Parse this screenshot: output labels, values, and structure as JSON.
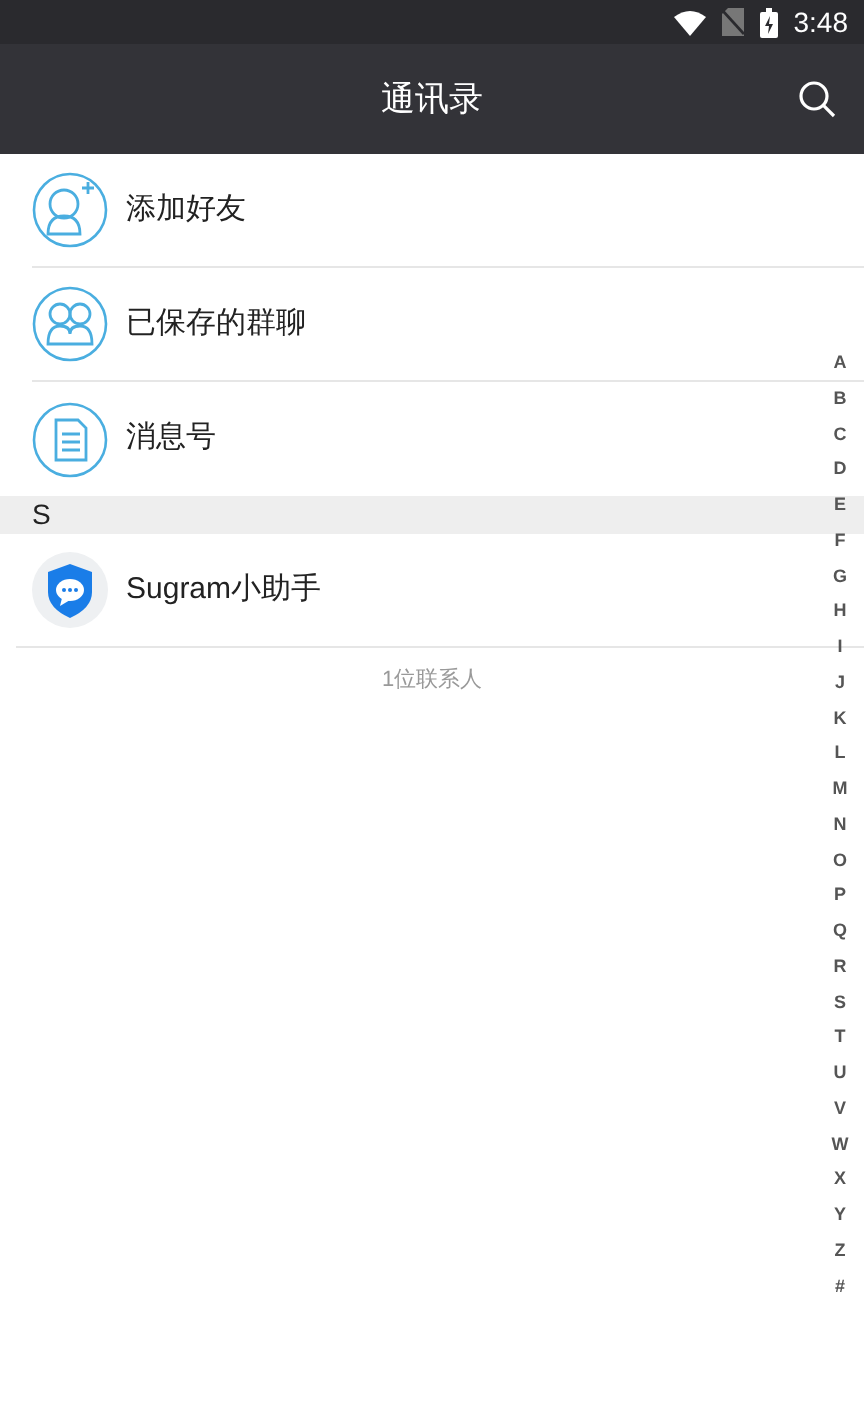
{
  "status_bar": {
    "time": "3:48"
  },
  "header": {
    "title": "通讯录"
  },
  "shortcuts": [
    {
      "kind": "add-friend",
      "label": "添加好友"
    },
    {
      "kind": "group",
      "label": "已保存的群聊"
    },
    {
      "kind": "document",
      "label": "消息号"
    }
  ],
  "sections": [
    {
      "letter": "S",
      "contacts": [
        {
          "name": "Sugram小助手"
        }
      ]
    }
  ],
  "contact_count": "1位联系人",
  "index": [
    "A",
    "B",
    "C",
    "D",
    "E",
    "F",
    "G",
    "H",
    "I",
    "J",
    "K",
    "L",
    "M",
    "N",
    "O",
    "P",
    "Q",
    "R",
    "S",
    "T",
    "U",
    "V",
    "W",
    "X",
    "Y",
    "Z",
    "#"
  ]
}
